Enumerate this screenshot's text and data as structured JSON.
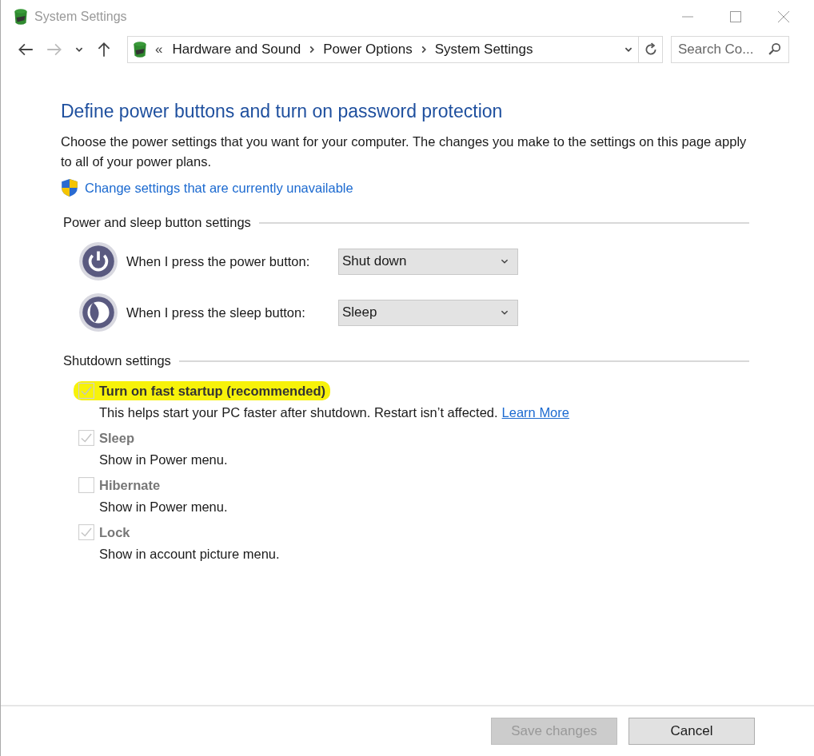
{
  "window": {
    "title": "System Settings"
  },
  "address_bar": {
    "overflow": "«",
    "crumbs": [
      "Hardware and Sound",
      "Power Options",
      "System Settings"
    ]
  },
  "search": {
    "placeholder": "Search Co..."
  },
  "heading": "Define power buttons and turn on password protection",
  "intro": "Choose the power settings that you want for your computer. The changes you make to the settings on this page apply to all of your power plans.",
  "admin_link": "Change settings that are currently unavailable",
  "button_section": {
    "title": "Power and sleep button settings",
    "rows": [
      {
        "kind": "power",
        "label": "When I press the power button:",
        "value": "Shut down"
      },
      {
        "kind": "sleep",
        "label": "When I press the sleep button:",
        "value": "Sleep"
      }
    ]
  },
  "shutdown_section": {
    "title": "Shutdown settings",
    "options": [
      {
        "label": "Turn on fast startup (recommended)",
        "description": "This helps start your PC faster after shutdown. Restart isn’t affected.",
        "link": "Learn More",
        "checked": true,
        "disabled": true,
        "highlighted": true
      },
      {
        "label": "Sleep",
        "description": "Show in Power menu.",
        "checked": true,
        "disabled": true,
        "highlighted": false
      },
      {
        "label": "Hibernate",
        "description": "Show in Power menu.",
        "checked": false,
        "disabled": true,
        "highlighted": false
      },
      {
        "label": "Lock",
        "description": "Show in account picture menu.",
        "checked": true,
        "disabled": true,
        "highlighted": false
      }
    ]
  },
  "buttons": [
    {
      "label": "Save changes",
      "disabled": true
    },
    {
      "label": "Cancel",
      "disabled": false
    }
  ]
}
